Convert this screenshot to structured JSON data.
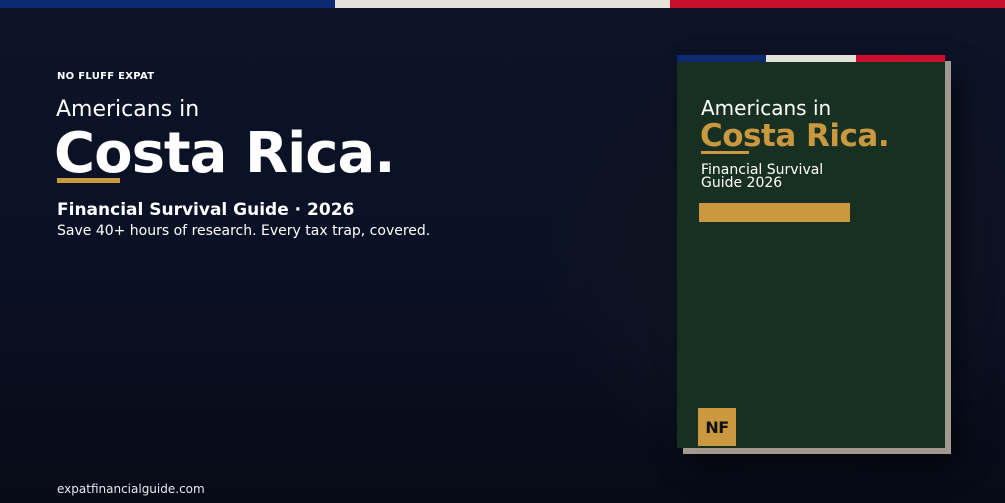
{
  "brand": "NO FLUFF EXPAT",
  "hero": {
    "title_small": "Americans in",
    "title_big": "Costa Rica.",
    "subtitle": "Financial Survival Guide · 2026",
    "tagline": "Save 40+ hours of research. Every tax trap, covered."
  },
  "footer": {
    "website": "expatfinancialguide.com"
  },
  "book": {
    "title_small": "Americans in",
    "title_big": "Costa Rica.",
    "subtitle": "Financial Survival Guide 2026",
    "logo": "NF"
  },
  "colors": {
    "flag_blue": "#0c2a72",
    "flag_white": "#e5e2da",
    "flag_red": "#c8102e",
    "accent_gold": "#c9983f",
    "book_green": "#173022",
    "background": "#0b1125"
  }
}
